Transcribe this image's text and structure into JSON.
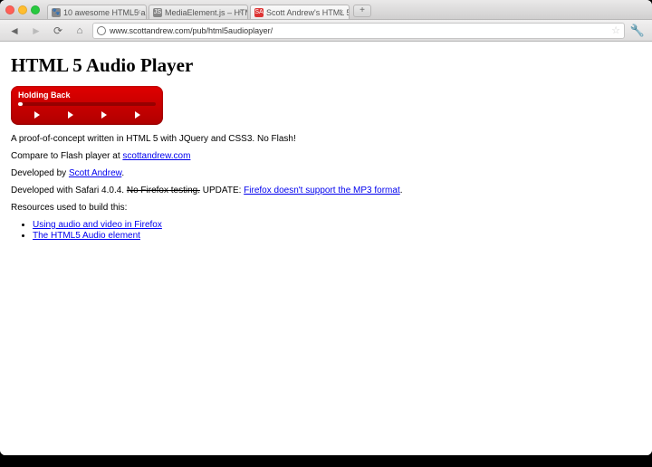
{
  "browser": {
    "tabs": [
      {
        "label": "10 awesome HTML5 audio p…",
        "active": false,
        "fav": "🐾"
      },
      {
        "label": "MediaElement.js – HTML5 …",
        "active": false,
        "fav": "JS"
      },
      {
        "label": "Scott Andrew's HTML 5 Au…",
        "active": true,
        "fav": "SA"
      }
    ],
    "url": "www.scottandrew.com/pub/html5audioplayer/"
  },
  "page": {
    "heading": "HTML 5 Audio Player",
    "player": {
      "track": "Holding Back"
    },
    "p1": "A proof-of-concept written in HTML 5 with JQuery and CSS3. No Flash!",
    "p2_a": "Compare to Flash player at ",
    "p2_link": "scottandrew.com",
    "p3_a": "Developed by ",
    "p3_link": "Scott Andrew",
    "p3_c": ".",
    "p4_a": "Developed with Safari 4.0.4. ",
    "p4_strike": "No Firefox testing.",
    "p4_b": " UPDATE: ",
    "p4_link": "Firefox doesn't support the MP3 format",
    "p4_c": ".",
    "p5": "Resources used to build this:",
    "res": [
      "Using audio and video in Firefox",
      "The HTML5 Audio element"
    ]
  }
}
